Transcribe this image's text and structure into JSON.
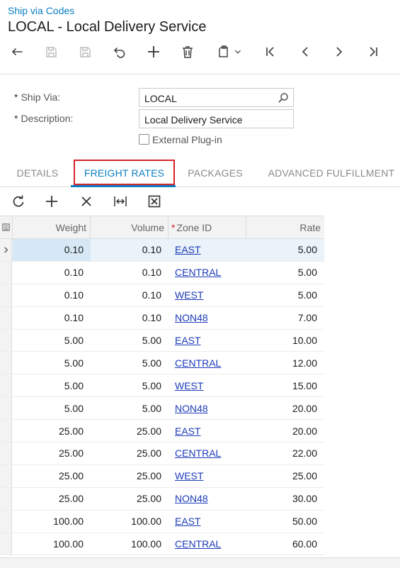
{
  "breadcrumb": "Ship via Codes",
  "title": "LOCAL - Local Delivery Service",
  "toolbar": {
    "buttons": [
      "undo-icon",
      "save-close-icon",
      "save-icon",
      "cancel-icon",
      "add-icon",
      "delete-icon",
      "copy-paste-icon",
      "first-record-icon",
      "previous-record-icon",
      "next-record-icon",
      "last-record-icon"
    ]
  },
  "form": {
    "ship_via_label": "Ship Via:",
    "ship_via_value": "LOCAL",
    "description_label": "Description:",
    "description_value": "Local Delivery Service",
    "required_mark": "*",
    "external_plugin_label": "External Plug-in",
    "external_plugin_checked": false
  },
  "tabs": [
    {
      "label": "DETAILS",
      "active": false
    },
    {
      "label": "FREIGHT RATES",
      "active": true
    },
    {
      "label": "PACKAGES",
      "active": false
    },
    {
      "label": "ADVANCED FULFILLMENT",
      "active": false
    }
  ],
  "grid": {
    "columns": {
      "weight": "Weight",
      "volume": "Volume",
      "zone_id": "Zone ID",
      "rate": "Rate"
    },
    "required_mark": "*",
    "rows": [
      {
        "weight": "0.10",
        "volume": "0.10",
        "zone": "EAST",
        "rate": "5.00"
      },
      {
        "weight": "0.10",
        "volume": "0.10",
        "zone": "CENTRAL",
        "rate": "5.00"
      },
      {
        "weight": "0.10",
        "volume": "0.10",
        "zone": "WEST",
        "rate": "5.00"
      },
      {
        "weight": "0.10",
        "volume": "0.10",
        "zone": "NON48",
        "rate": "7.00"
      },
      {
        "weight": "5.00",
        "volume": "5.00",
        "zone": "EAST",
        "rate": "10.00"
      },
      {
        "weight": "5.00",
        "volume": "5.00",
        "zone": "CENTRAL",
        "rate": "12.00"
      },
      {
        "weight": "5.00",
        "volume": "5.00",
        "zone": "WEST",
        "rate": "15.00"
      },
      {
        "weight": "5.00",
        "volume": "5.00",
        "zone": "NON48",
        "rate": "20.00"
      },
      {
        "weight": "25.00",
        "volume": "25.00",
        "zone": "EAST",
        "rate": "20.00"
      },
      {
        "weight": "25.00",
        "volume": "25.00",
        "zone": "CENTRAL",
        "rate": "22.00"
      },
      {
        "weight": "25.00",
        "volume": "25.00",
        "zone": "WEST",
        "rate": "25.00"
      },
      {
        "weight": "25.00",
        "volume": "25.00",
        "zone": "NON48",
        "rate": "30.00"
      },
      {
        "weight": "100.00",
        "volume": "100.00",
        "zone": "EAST",
        "rate": "50.00"
      },
      {
        "weight": "100.00",
        "volume": "100.00",
        "zone": "CENTRAL",
        "rate": "60.00"
      }
    ]
  },
  "colors": {
    "accent": "#0a7fc2",
    "highlight_box": "#d8232a",
    "link": "#1c3ab8"
  }
}
